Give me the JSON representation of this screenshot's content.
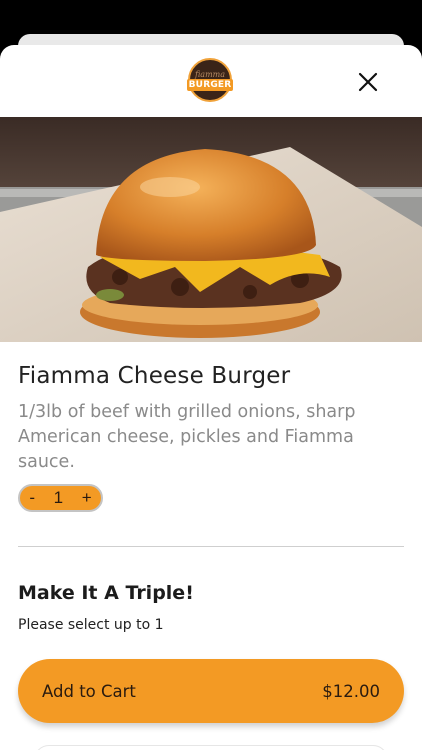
{
  "logo": {
    "script_text": "fiamma",
    "word_text": "BURGER"
  },
  "header": {
    "close_icon": "close-icon"
  },
  "item": {
    "name": "Fiamma Cheese Burger",
    "description": "1/3lb of beef with grilled onions, sharp American cheese, pickles and Fiamma sauce.",
    "quantity": {
      "minus": "-",
      "value": "1",
      "plus": "+"
    }
  },
  "options": {
    "title": "Make It A Triple!",
    "subtitle": "Please select up to 1"
  },
  "cart": {
    "label": "Add to Cart",
    "price": "$12.00"
  },
  "colors": {
    "accent": "#f39a24",
    "background_dark": "#000000",
    "text_primary": "#222222",
    "text_secondary": "#8a8a8a"
  }
}
